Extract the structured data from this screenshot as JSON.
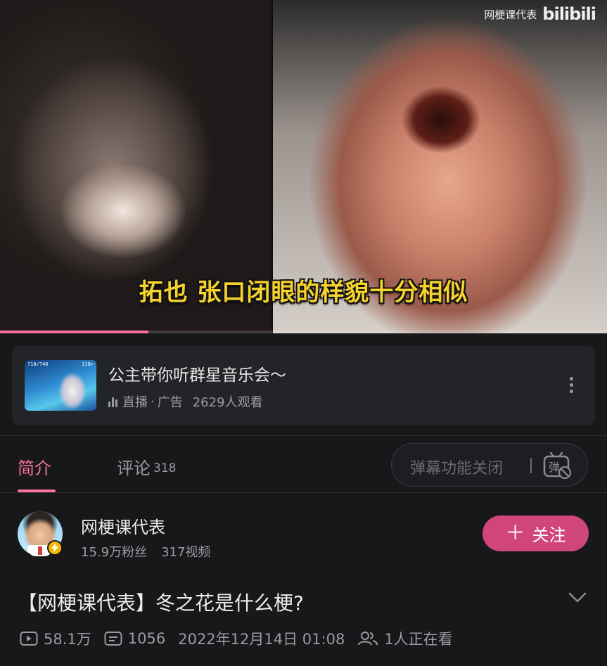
{
  "player": {
    "watermark_text": "网梗课代表",
    "watermark_logo": "bilibili",
    "subtitle": "拓也 张口闭眼的样貌十分相似",
    "progress_fraction": 0.245,
    "accent_color": "#fb7299"
  },
  "ad_card": {
    "title": "公主带你听群星音乐会～",
    "live_label": "直播",
    "separator": "·",
    "ad_label": "广告",
    "viewers": "2629人观看",
    "thumb_left_text": "718/740",
    "thumb_right_text": "118+"
  },
  "tabs": {
    "intro": "简介",
    "comments": "评论",
    "comments_count": "318"
  },
  "danmaku": {
    "placeholder": "弹幕功能关闭",
    "toggle_glyph": "弹"
  },
  "uploader": {
    "name": "网梗课代表",
    "fans": "15.9万粉丝",
    "videos": "317视频",
    "follow_label": "关注",
    "follow_color": "#d0467a"
  },
  "video": {
    "title": "【网梗课代表】冬之花是什么梗?",
    "views": "58.1万",
    "danmaku_count": "1056",
    "published": "2022年12月14日 01:08",
    "watching_now": "1人正在看"
  },
  "icons": {
    "live": "live-bars-icon",
    "more": "more-vertical-icon",
    "danmaku_toggle": "danmaku-off-icon",
    "verified": "lightning-badge-icon",
    "chevron": "chevron-down-icon",
    "play": "play-count-icon",
    "danmaku": "danmaku-count-icon",
    "people": "people-icon"
  }
}
